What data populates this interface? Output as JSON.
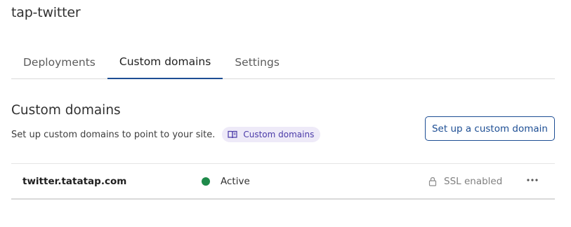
{
  "project": {
    "title": "tap-twitter"
  },
  "tabs": [
    {
      "label": "Deployments",
      "active": false
    },
    {
      "label": "Custom domains",
      "active": true
    },
    {
      "label": "Settings",
      "active": false
    }
  ],
  "section": {
    "title": "Custom domains",
    "description": "Set up custom domains to point to your site.",
    "doc_link_label": "Custom domains",
    "doc_link_icon": "book-icon"
  },
  "setup_button": {
    "label": "Set up a custom domain"
  },
  "domains": [
    {
      "name": "twitter.tatatap.com",
      "status": "Active",
      "status_color": "#1e8a4a",
      "ssl_label": "SSL enabled",
      "ssl_icon": "lock-icon",
      "menu_icon": "more-horizontal-icon"
    }
  ],
  "colors": {
    "accent": "#1d4e94",
    "doc_link_bg": "#eeeaf8",
    "doc_link_text": "#4a3aa8"
  }
}
